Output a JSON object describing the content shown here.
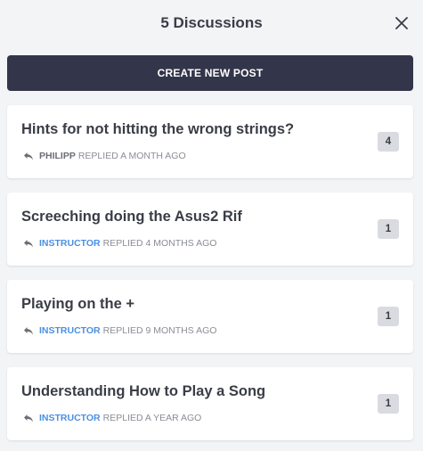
{
  "header": {
    "title": "5 Discussions",
    "close_icon": "close-icon"
  },
  "actions": {
    "create_label": "CREATE NEW POST",
    "create_bg": "#33354a"
  },
  "colors": {
    "instructor": "#4a90e2",
    "badge_bg": "#d9dbe0",
    "background": "#f3f4f6"
  },
  "discussions": [
    {
      "title": "Hints for not hitting the wrong strings?",
      "author": "PHILIPP",
      "author_role": "user",
      "meta": "REPLIED A MONTH AGO",
      "count": "4"
    },
    {
      "title": "Screeching doing the Asus2 Rif",
      "author": "INSTRUCTOR",
      "author_role": "instructor",
      "meta": "REPLIED 4 MONTHS AGO",
      "count": "1"
    },
    {
      "title": "Playing on the +",
      "author": "INSTRUCTOR",
      "author_role": "instructor",
      "meta": "REPLIED 9 MONTHS AGO",
      "count": "1"
    },
    {
      "title": "Understanding How to Play a Song",
      "author": "INSTRUCTOR",
      "author_role": "instructor",
      "meta": "REPLIED A YEAR AGO",
      "count": "1"
    }
  ]
}
